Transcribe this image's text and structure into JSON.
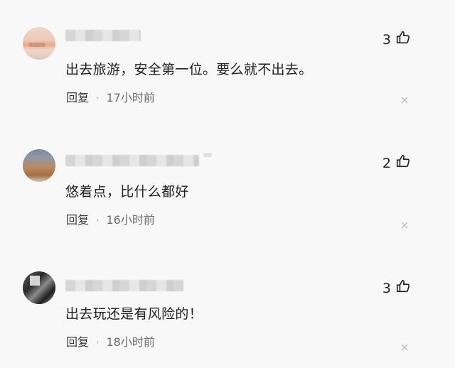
{
  "comments": [
    {
      "text": "出去旅游，安全第一位。要么就不出去。",
      "reply_label": "回复",
      "time": "17小时前",
      "likes": "3"
    },
    {
      "text": "悠着点，比什么都好",
      "reply_label": "回复",
      "time": "16小时前",
      "likes": "2"
    },
    {
      "text": "出去玩还是有风险的！",
      "reply_label": "回复",
      "time": "18小时前",
      "likes": "3"
    }
  ],
  "icons": {
    "like": "thumbs-up-icon",
    "close": "close-icon"
  },
  "colors": {
    "background": "#f8f8f8",
    "text": "#222222",
    "meta": "#6b6b6b"
  }
}
